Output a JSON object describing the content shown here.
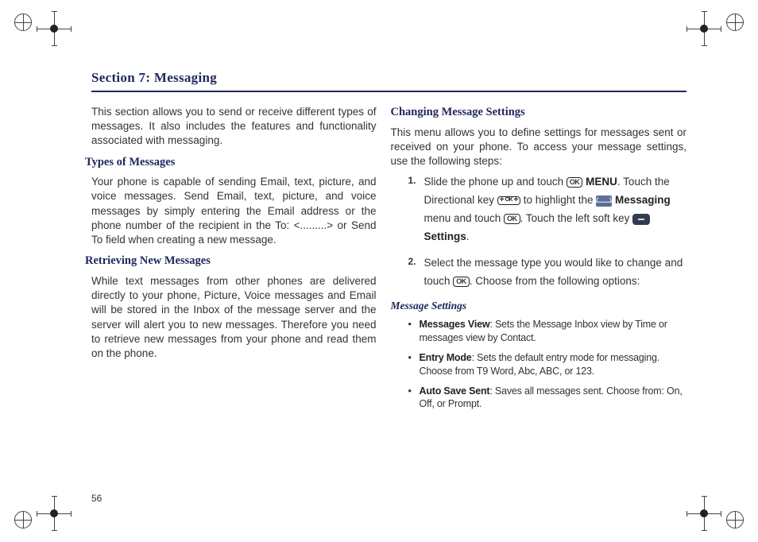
{
  "page_number": "56",
  "section_title": "Section 7:  Messaging",
  "left": {
    "intro": "This section allows you to send or receive different types of messages. It also includes the features and functionality associated with messaging.",
    "h_types": "Types of Messages",
    "types_body": "Your phone is capable of sending Email, text, picture, and voice messages. Send Email, text, picture, and voice messages by simply entering the Email address or the phone number of the recipient in the To: <.........> or Send To field when creating a new message.",
    "h_retrieve": "Retrieving New Messages",
    "retrieve_body": "While text messages from other phones are delivered directly to your phone, Picture, Voice messages and Email will be stored in the Inbox of the message server and the server will alert you to new messages. Therefore you need to retrieve new messages from your phone and read them on the phone."
  },
  "right": {
    "h_changing": "Changing Message Settings",
    "changing_intro": "This menu allows you to define settings for messages sent or received on your phone. To access your message settings, use the following steps:",
    "step1_a": "Slide the phone up and touch ",
    "step1_menu": " MENU",
    "step1_b": ". Touch the Directional key ",
    "step1_c": " to highlight the ",
    "step1_msg": " Messaging",
    "step1_d": " menu and touch ",
    "step1_e": ". Touch the left soft key ",
    "step1_settings": "Settings",
    "step1_f": ".",
    "step2_a": "Select the message type you would like to change and touch ",
    "step2_b": ". Choose from the following options:",
    "h_msg_settings": "Message Settings",
    "bullets": [
      {
        "bold": "Messages View",
        "rest": ": Sets the Message Inbox view by Time or messages view by Contact."
      },
      {
        "bold": "Entry Mode",
        "rest": ": Sets the default entry mode for messaging. Choose from T9 Word, Abc, ABC, or 123."
      },
      {
        "bold": "Auto Save Sent",
        "rest": ": Saves all messages sent. Choose from: On, Off, or Prompt."
      }
    ]
  },
  "icons": {
    "ok": "OK"
  }
}
